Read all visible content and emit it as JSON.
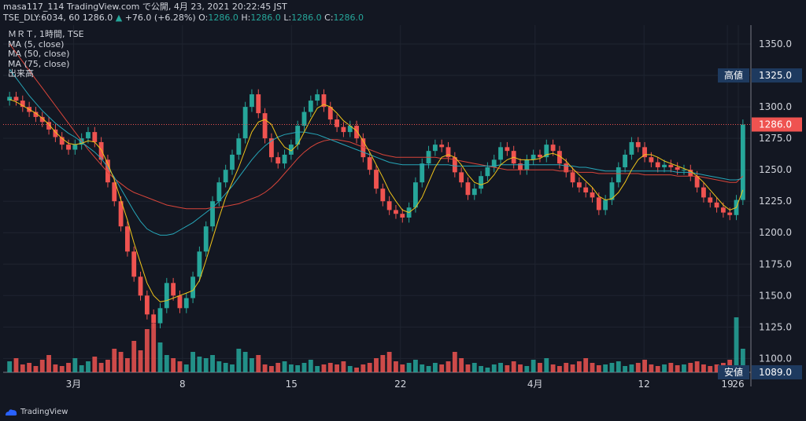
{
  "header": {
    "line1": "masa117_114 TradingView.com で公開, 4月 23, 2021 20:22:45 JST",
    "line2_prefix": "TSE_DLY:6034, 60 1286.0",
    "change": "+76.0 (+6.28%)",
    "o_label": "O:",
    "o_value": "1286.0",
    "h_label": "H:",
    "h_value": "1286.0",
    "l_label": "L:",
    "l_value": "1286.0",
    "c_label": "C:",
    "c_value": "1286.0"
  },
  "legend": {
    "symbol": "ＭＲＴ, 1時間, TSE",
    "ma5": "MA (5, close)",
    "ma50": "MA (50, close)",
    "ma75": "MA (75, close)",
    "volume": "出来高"
  },
  "footer": {
    "brand": "TradingView"
  },
  "colors": {
    "bg": "#131722",
    "grid": "#1f2430",
    "up": "#26a69a",
    "down": "#ef5350",
    "ma5": "#f0c419",
    "ma50": "#26a6b8",
    "ma75": "#d9453a",
    "text": "#d1d4dc"
  },
  "chart_data": {
    "type": "candlestick",
    "ylim": [
      1089,
      1365
    ],
    "y_ticks": [
      1350.0,
      1325.0,
      1300.0,
      1275.0,
      1250.0,
      1225.0,
      1200.0,
      1175.0,
      1150.0,
      1125.0,
      1100.0
    ],
    "y_tick_labels": [
      "1350.0",
      "1325.0",
      "1300.0",
      "1275.0",
      "1250.0",
      "1225.0",
      "1200.0",
      "1175.0",
      "1150.0",
      "1125.0",
      "1100.0"
    ],
    "x_ticks": [
      "3月",
      "8",
      "15",
      "22",
      "4月",
      "12",
      "19",
      "26"
    ],
    "price_tags": [
      {
        "name": "高値",
        "value": 1325.0,
        "label": "1325.0"
      },
      {
        "name": "current",
        "value": 1286.0,
        "label": "1286.0"
      },
      {
        "name": "安値",
        "value": 1089.0,
        "label": "1089.0"
      }
    ],
    "close": [
      1308,
      1305,
      1300,
      1296,
      1292,
      1288,
      1282,
      1276,
      1270,
      1266,
      1270,
      1275,
      1280,
      1272,
      1258,
      1240,
      1225,
      1205,
      1185,
      1165,
      1150,
      1135,
      1128,
      1140,
      1160,
      1150,
      1140,
      1148,
      1165,
      1185,
      1205,
      1225,
      1240,
      1250,
      1262,
      1275,
      1300,
      1310,
      1295,
      1275,
      1260,
      1255,
      1262,
      1270,
      1285,
      1296,
      1305,
      1310,
      1300,
      1290,
      1284,
      1280,
      1285,
      1275,
      1260,
      1250,
      1235,
      1225,
      1218,
      1215,
      1212,
      1220,
      1240,
      1255,
      1265,
      1270,
      1268,
      1260,
      1248,
      1240,
      1230,
      1235,
      1245,
      1252,
      1258,
      1268,
      1265,
      1255,
      1250,
      1258,
      1262,
      1260,
      1270,
      1265,
      1255,
      1248,
      1240,
      1236,
      1232,
      1228,
      1218,
      1226,
      1240,
      1252,
      1262,
      1272,
      1268,
      1260,
      1256,
      1252,
      1254,
      1252,
      1250,
      1250,
      1245,
      1236,
      1228,
      1224,
      1220,
      1216,
      1214,
      1226,
      1286
    ],
    "ma5": [
      1306,
      1304,
      1301,
      1298,
      1295,
      1291,
      1286,
      1280,
      1275,
      1271,
      1270,
      1271,
      1273,
      1272,
      1266,
      1255,
      1242,
      1226,
      1210,
      1192,
      1176,
      1160,
      1150,
      1145,
      1146,
      1148,
      1150,
      1152,
      1154,
      1162,
      1178,
      1195,
      1212,
      1228,
      1240,
      1252,
      1266,
      1280,
      1288,
      1290,
      1286,
      1275,
      1268,
      1265,
      1270,
      1280,
      1290,
      1299,
      1302,
      1300,
      1295,
      1289,
      1285,
      1281,
      1273,
      1264,
      1254,
      1244,
      1233,
      1225,
      1218,
      1216,
      1220,
      1228,
      1240,
      1252,
      1260,
      1262,
      1260,
      1254,
      1246,
      1240,
      1238,
      1240,
      1246,
      1254,
      1258,
      1260,
      1258,
      1258,
      1258,
      1259,
      1262,
      1263,
      1261,
      1257,
      1251,
      1246,
      1241,
      1236,
      1229,
      1226,
      1227,
      1232,
      1240,
      1250,
      1258,
      1262,
      1262,
      1260,
      1257,
      1255,
      1253,
      1251,
      1249,
      1245,
      1240,
      1234,
      1228,
      1222,
      1218,
      1220,
      1234
    ],
    "ma50": [
      1330,
      1323,
      1316,
      1309,
      1303,
      1297,
      1292,
      1287,
      1283,
      1279,
      1276,
      1272,
      1268,
      1264,
      1259,
      1252,
      1244,
      1235,
      1226,
      1217,
      1209,
      1203,
      1200,
      1198,
      1198,
      1199,
      1202,
      1205,
      1208,
      1212,
      1216,
      1220,
      1225,
      1231,
      1237,
      1244,
      1251,
      1258,
      1264,
      1269,
      1273,
      1276,
      1278,
      1279,
      1280,
      1280,
      1279,
      1278,
      1276,
      1274,
      1272,
      1270,
      1268,
      1266,
      1264,
      1262,
      1260,
      1258,
      1256,
      1255,
      1254,
      1254,
      1254,
      1254,
      1254,
      1254,
      1254,
      1254,
      1253,
      1253,
      1253,
      1253,
      1253,
      1253,
      1253,
      1254,
      1254,
      1254,
      1254,
      1254,
      1254,
      1254,
      1254,
      1254,
      1254,
      1253,
      1253,
      1252,
      1252,
      1251,
      1250,
      1249,
      1249,
      1249,
      1249,
      1249,
      1249,
      1249,
      1249,
      1249,
      1249,
      1249,
      1248,
      1248,
      1248,
      1247,
      1246,
      1245,
      1244,
      1243,
      1242,
      1242,
      1243
    ],
    "ma75": [
      1350,
      1343,
      1336,
      1329,
      1322,
      1315,
      1308,
      1301,
      1294,
      1287,
      1280,
      1273,
      1266,
      1260,
      1254,
      1248,
      1243,
      1239,
      1235,
      1232,
      1230,
      1228,
      1226,
      1224,
      1222,
      1221,
      1220,
      1219,
      1219,
      1219,
      1219,
      1220,
      1220,
      1221,
      1222,
      1223,
      1225,
      1227,
      1229,
      1232,
      1236,
      1241,
      1247,
      1253,
      1259,
      1264,
      1268,
      1271,
      1273,
      1274,
      1274,
      1273,
      1272,
      1270,
      1268,
      1266,
      1264,
      1262,
      1261,
      1260,
      1260,
      1260,
      1260,
      1260,
      1260,
      1260,
      1259,
      1259,
      1258,
      1257,
      1256,
      1255,
      1254,
      1253,
      1252,
      1251,
      1250,
      1250,
      1250,
      1250,
      1250,
      1250,
      1250,
      1250,
      1249,
      1249,
      1249,
      1248,
      1248,
      1248,
      1247,
      1247,
      1247,
      1247,
      1247,
      1247,
      1247,
      1246,
      1246,
      1246,
      1246,
      1246,
      1245,
      1245,
      1245,
      1245,
      1244,
      1243,
      1242,
      1241,
      1240,
      1240,
      1245
    ],
    "volume": [
      14,
      18,
      10,
      12,
      8,
      16,
      22,
      10,
      8,
      12,
      18,
      9,
      14,
      20,
      12,
      16,
      30,
      26,
      18,
      40,
      28,
      55,
      62,
      38,
      22,
      18,
      14,
      10,
      26,
      20,
      18,
      22,
      14,
      12,
      10,
      30,
      26,
      18,
      22,
      10,
      8,
      12,
      14,
      10,
      9,
      12,
      16,
      8,
      10,
      12,
      10,
      14,
      8,
      6,
      10,
      12,
      18,
      22,
      26,
      14,
      10,
      12,
      16,
      10,
      8,
      12,
      10,
      14,
      26,
      18,
      10,
      12,
      8,
      6,
      10,
      12,
      9,
      14,
      10,
      8,
      16,
      12,
      18,
      10,
      8,
      12,
      10,
      14,
      18,
      12,
      9,
      10,
      12,
      14,
      8,
      10,
      12,
      16,
      10,
      8,
      10,
      12,
      9,
      10,
      12,
      14,
      10,
      8,
      10,
      12,
      16,
      70,
      30
    ]
  }
}
